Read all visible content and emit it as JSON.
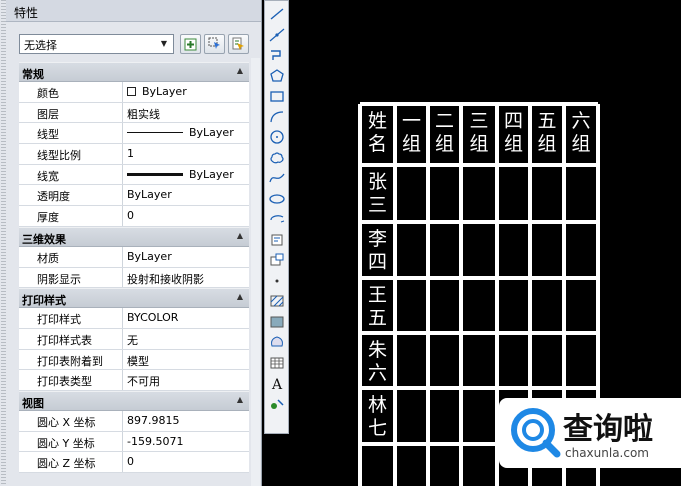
{
  "palette": {
    "title": "特性",
    "selection": "无选择",
    "categories": [
      {
        "name": "常规",
        "rows": [
          {
            "key": "颜色",
            "value": "ByLayer",
            "swatch": true
          },
          {
            "key": "图层",
            "value": "粗实线"
          },
          {
            "key": "线型",
            "value": "ByLayer",
            "line": "thin"
          },
          {
            "key": "线型比例",
            "value": "1"
          },
          {
            "key": "线宽",
            "value": "ByLayer",
            "line": "thick"
          },
          {
            "key": "透明度",
            "value": "ByLayer"
          },
          {
            "key": "厚度",
            "value": "0"
          }
        ]
      },
      {
        "name": "三维效果",
        "rows": [
          {
            "key": "材质",
            "value": "ByLayer"
          },
          {
            "key": "阴影显示",
            "value": "投射和接收阴影"
          }
        ]
      },
      {
        "name": "打印样式",
        "rows": [
          {
            "key": "打印样式",
            "value": "BYCOLOR"
          },
          {
            "key": "打印样式表",
            "value": "无"
          },
          {
            "key": "打印表附着到",
            "value": "模型"
          },
          {
            "key": "打印表类型",
            "value": "不可用"
          }
        ]
      },
      {
        "name": "视图",
        "rows": [
          {
            "key": "圆心 X 坐标",
            "value": "897.9815"
          },
          {
            "key": "圆心 Y 坐标",
            "value": "-159.5071"
          },
          {
            "key": "圆心 Z 坐标",
            "value": "0"
          }
        ]
      }
    ]
  },
  "toolbar": {
    "tools": [
      "line-icon",
      "construction-line-icon",
      "polyline-icon",
      "polygon-icon",
      "rectangle-icon",
      "arc-icon",
      "circle-icon",
      "revision-cloud-icon",
      "spline-icon",
      "ellipse-icon",
      "ellipse-arc-icon",
      "insert-block-icon",
      "make-block-icon",
      "point-icon",
      "hatch-icon",
      "gradient-icon",
      "region-icon",
      "table-icon",
      "multiline-text-icon",
      "add-selected-icon"
    ]
  },
  "drawing": {
    "header": {
      "label": "姓名",
      "groups": [
        "一组",
        "二组",
        "三组",
        "四组",
        "五组",
        "六组"
      ]
    },
    "names": [
      "张三",
      "李四",
      "王五",
      "朱六",
      "林七",
      ""
    ]
  },
  "watermark": {
    "brand": "查询啦",
    "url": "chaxunla.com"
  },
  "colors": {
    "panel": "#e3e6ec",
    "canvas": "#000000",
    "lines": "#ffffff",
    "brand": "#1e88e5"
  }
}
